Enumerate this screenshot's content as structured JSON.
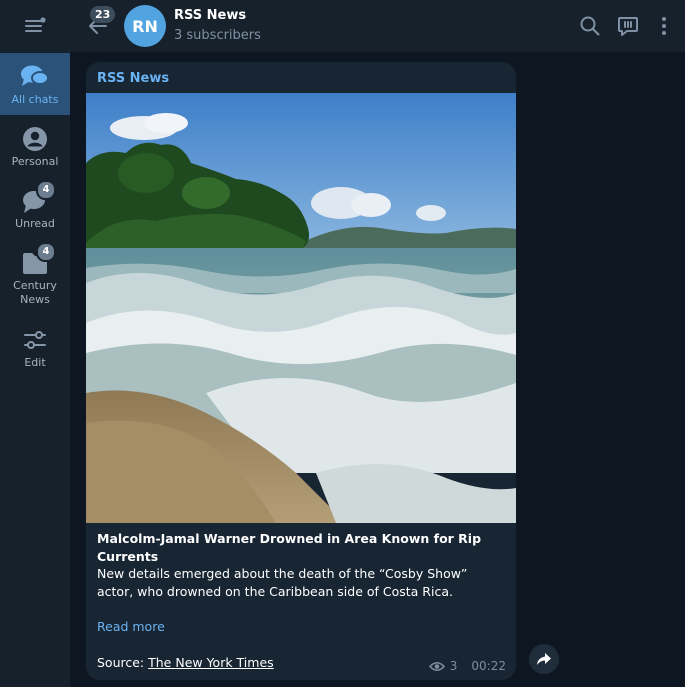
{
  "sidebar": {
    "folders": [
      {
        "label": "All chats",
        "badge": ""
      },
      {
        "label": "Personal",
        "badge": ""
      },
      {
        "label": "Unread",
        "badge": "4"
      },
      {
        "label": "Century News",
        "badge": "4"
      },
      {
        "label": "Edit",
        "badge": ""
      }
    ]
  },
  "header": {
    "back_unread_count": "23",
    "avatar_initials": "RN",
    "title": "RSS News",
    "subtitle": "3 subscribers"
  },
  "message": {
    "author": "RSS News",
    "photo_icon": "beach-waves-photo",
    "title": "Malcolm-Jamal Warner Drowned in Area Known for Rip Currents",
    "body": "New details emerged about the death of the “Cosby Show” actor, who drowned on the Caribbean side of Costa Rica.",
    "read_more": "Read more",
    "source_prefix": "Source: ",
    "source_link": "The New York Times",
    "views": "3",
    "time": "00:22"
  },
  "colors": {
    "accent": "#6ab3f3",
    "sidebar_bg": "#17212b",
    "chat_bg": "#0e1621",
    "bubble_bg": "#182533",
    "active_folder": "#2b5278"
  }
}
